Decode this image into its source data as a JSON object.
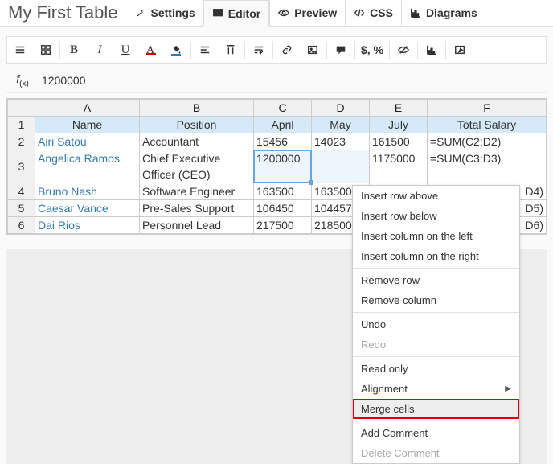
{
  "header": {
    "title": "My First Table",
    "tabs": [
      {
        "label": "Settings",
        "icon": "wrench-icon",
        "active": false
      },
      {
        "label": "Editor",
        "icon": "grid-icon",
        "active": true
      },
      {
        "label": "Preview",
        "icon": "eye-icon",
        "active": false
      },
      {
        "label": "CSS",
        "icon": "code-icon",
        "active": false
      },
      {
        "label": "Diagrams",
        "icon": "chart-icon",
        "active": false
      }
    ]
  },
  "toolbar": [
    {
      "name": "menu-icon",
      "type": "icon"
    },
    {
      "name": "tiles-icon",
      "type": "icon"
    },
    {
      "name": "divider"
    },
    {
      "name": "bold-icon",
      "type": "bold"
    },
    {
      "name": "italic-icon",
      "type": "italic"
    },
    {
      "name": "underline-icon",
      "type": "underline"
    },
    {
      "name": "text-color-icon",
      "type": "colorA",
      "under": "#d00000"
    },
    {
      "name": "fill-color-icon",
      "type": "fill",
      "under": "#1b7fd0"
    },
    {
      "name": "divider"
    },
    {
      "name": "align-left-icon",
      "type": "icon"
    },
    {
      "name": "align-top-icon",
      "type": "icon"
    },
    {
      "name": "divider"
    },
    {
      "name": "wrap-text-icon",
      "type": "icon"
    },
    {
      "name": "divider"
    },
    {
      "name": "link-icon",
      "type": "icon"
    },
    {
      "name": "image-icon",
      "type": "icon"
    },
    {
      "name": "divider"
    },
    {
      "name": "comment-icon",
      "type": "icon"
    },
    {
      "name": "divider"
    },
    {
      "name": "currency-icon",
      "type": "text",
      "label": "$, %"
    },
    {
      "name": "divider"
    },
    {
      "name": "hide-icon",
      "type": "icon"
    },
    {
      "name": "divider"
    },
    {
      "name": "mini-chart-icon",
      "type": "icon"
    },
    {
      "name": "divider"
    },
    {
      "name": "edit-icon",
      "type": "icon"
    }
  ],
  "formula": {
    "value": "1200000"
  },
  "spreadsheet": {
    "columns": [
      "A",
      "B",
      "C",
      "D",
      "E",
      "F"
    ],
    "header_row": [
      "Name",
      "Position",
      "April",
      "May",
      "July",
      "Total Salary"
    ],
    "rows": [
      {
        "n": 2,
        "name": "Airi Satou",
        "position": "Accountant",
        "april": "15456",
        "may": "14023",
        "july": "161500",
        "total": "=SUM(C2;D2)"
      },
      {
        "n": 3,
        "name": "Angelica Ramos",
        "position": "Chief Executive Officer (CEO)",
        "april": "1200000",
        "may": "",
        "july": "1175000",
        "total": "=SUM(C3:D3)",
        "selected": true,
        "tall": true
      },
      {
        "n": 4,
        "name": "Bruno Nash",
        "position": "Software Engineer",
        "april": "163500",
        "may": "163500",
        "july": "",
        "total": "D4)",
        "cutoff": true
      },
      {
        "n": 5,
        "name": "Caesar Vance",
        "position": "Pre-Sales Support",
        "april": "106450",
        "may": "104457",
        "july": "",
        "total": "D5)",
        "cutoff": true
      },
      {
        "n": 6,
        "name": "Dai Rios",
        "position": "Personnel Lead",
        "april": "217500",
        "may": "218500",
        "july": "",
        "total": "D6)",
        "cutoff": true
      }
    ]
  },
  "contextmenu": {
    "items": [
      {
        "label": "Insert row above"
      },
      {
        "label": "Insert row below"
      },
      {
        "label": "Insert column on the left"
      },
      {
        "label": "Insert column on the right"
      },
      {
        "sep": true
      },
      {
        "label": "Remove row"
      },
      {
        "label": "Remove column"
      },
      {
        "sep": true
      },
      {
        "label": "Undo"
      },
      {
        "label": "Redo",
        "disabled": true
      },
      {
        "sep": true
      },
      {
        "label": "Read only"
      },
      {
        "label": "Alignment",
        "submenu": true
      },
      {
        "label": "Merge cells",
        "highlight": true
      },
      {
        "sep": true
      },
      {
        "label": "Add Comment"
      },
      {
        "label": "Delete Comment",
        "disabled": true
      }
    ]
  }
}
